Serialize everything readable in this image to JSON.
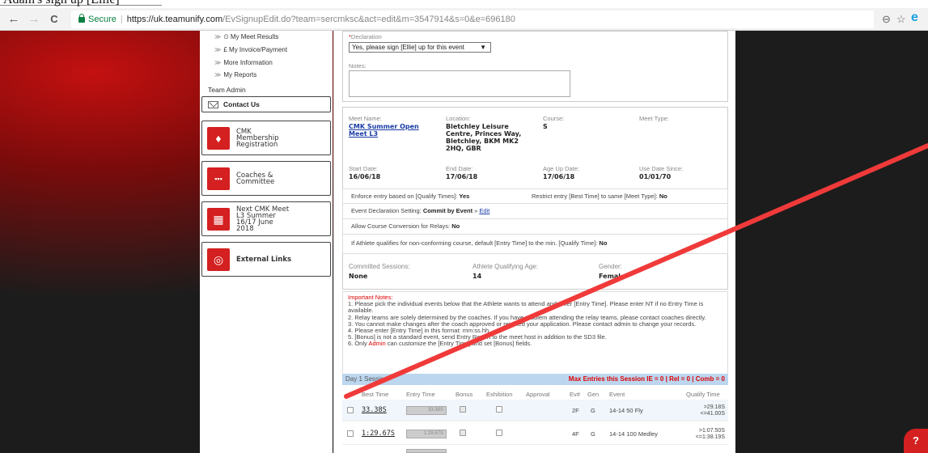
{
  "caption": "Adam's sign up [Ellie]",
  "browser": {
    "back": "←",
    "forward": "→",
    "reload": "C",
    "secure_label": "Secure",
    "url_host": "https://uk.teamunify.com",
    "url_path": "/EvSignupEdit.do?team=sercmksc&act=edit&m=3547914&s=0&e=696180",
    "zoom_icon": "⊖",
    "star_icon": "☆",
    "ext_icon": "e"
  },
  "sidebar": {
    "links": [
      "My Meet Results",
      "£ My Invoice/Payment",
      "More Information",
      "My Reports"
    ],
    "team_admin": "Team Admin",
    "contact": "Contact Us",
    "tiles": [
      {
        "label": "CMK\nMembership\nRegistration",
        "icon": "♦"
      },
      {
        "label": "Coaches &\nCommittee",
        "icon": "▪▪▪"
      },
      {
        "label": "Next CMK Meet\nL3 Summer\n16/17 June\n2018",
        "icon": "▦"
      },
      {
        "label": "External Links",
        "icon": "◎"
      }
    ]
  },
  "form": {
    "declaration_label": "Declaration",
    "declaration_value": "Yes, please sign [Ellie] up for this event",
    "notes_label": "Notes:"
  },
  "meet": {
    "name_label": "Meet Name:",
    "name": "CMK Summer Open Meet L3",
    "location_label": "Location:",
    "location": "Bletchley Leisure Centre, Princes Way, Bletchley, BKM MK2 2HQ, GBR",
    "course_label": "Course:",
    "course": "S",
    "type_label": "Meet Type:",
    "start_label": "Start Date:",
    "start": "16/06/18",
    "end_label": "End Date:",
    "end": "17/06/18",
    "ageup_label": "Age Up Date:",
    "ageup": "17/06/18",
    "usedate_label": "Use Date Since:",
    "usedate": "01/01/70"
  },
  "settings": {
    "enforce_label": "Enforce entry based on [Qualify Times]:",
    "enforce_value": "Yes",
    "restrict_label": "Restrict entry [Best Time] to same [Meet Type]:",
    "restrict_value": "No",
    "decl_label": "Event Declaration Setting:",
    "decl_value": "Commit by Event",
    "decl_edit": "Edit",
    "conv_label": "Allow Course Conversion for Relays:",
    "conv_value": "No",
    "nonconf_label": "If Athlete qualifies for non-conforming course, default [Entry Time] to the min. [Qualify Time]:",
    "nonconf_value": "No"
  },
  "athlete": {
    "sessions_label": "Committed Sessions:",
    "sessions": "None",
    "age_label": "Athlete Qualifying Age:",
    "age": "14",
    "gender_label": "Gender:",
    "gender": "Female"
  },
  "notes": {
    "heading": "Important Notes:",
    "n1": "1. Please pick the individual events below that the Athlete wants to attend and enter [Entry Time]. Please enter NT if no Entry Time is available.",
    "n2": "2. Relay teams are solely determined by the coaches. If you have problem attending the relay teams, please contact coaches directly.",
    "n3": "3. You cannot make changes after the coach approved or rejected your application. Please contact admin to change your records.",
    "n4": "4. Please enter [Entry Time] in this format: mm:ss.hh.",
    "n5": "5. [Bonus] is not a standard event, send Entry Report to the meet host in addition to the SD3 file.",
    "n6a": "6. Only ",
    "n6_admin": "Admin",
    "n6b": " can customize the [Entry Time] and set [Bonus] fields."
  },
  "session": {
    "title": "Day 1 Session",
    "max": "Max Entries this Session IE = 0 | Rel = 0 | Comb = 0"
  },
  "table": {
    "headers": [
      "Best Time",
      "Entry Time",
      "Bonus",
      "Exhibition",
      "Approval",
      "Ev#",
      "Gen",
      "Event",
      "Qualify Time"
    ],
    "rows": [
      {
        "best": "33.38S",
        "entry": "33.38S",
        "ev": "2F",
        "gen": "G",
        "event": "14-14 50 Fly",
        "qualify": ">29.18S\n<=41.00S"
      },
      {
        "best": "1:29.67S",
        "entry": "1:29.67S",
        "ev": "4F",
        "gen": "G",
        "event": "14-14 100 Medley",
        "qualify": ">1:07.50S\n<=1:38.19S"
      }
    ]
  },
  "help": "?"
}
